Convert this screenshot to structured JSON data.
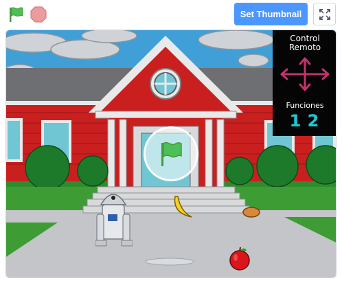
{
  "toolbar": {
    "green_flag_icon": "green-flag-icon",
    "stop_icon": "stop-icon",
    "set_thumbnail_label": "Set Thumbnail",
    "fullscreen_icon": "fullscreen-icon"
  },
  "stage": {
    "hud": {
      "title_line1": "Control",
      "title_line2": "Remoto",
      "functions_label": "Funciones",
      "function_1": "1",
      "function_2": "2"
    },
    "sprites": [
      "robot",
      "banana",
      "apple",
      "bread",
      "house"
    ],
    "overlay_icon": "green-flag-icon"
  },
  "colors": {
    "accent_blue": "#4c97ff",
    "flag_green": "#4cbf56",
    "stop_red": "#ec9c9c",
    "hud_arrow": "#c2336e",
    "hud_number": "#22c5cf"
  }
}
